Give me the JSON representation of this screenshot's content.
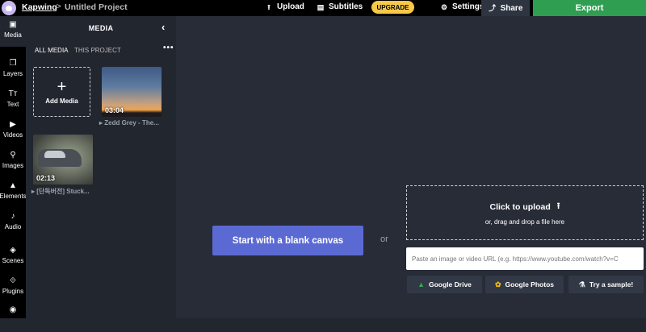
{
  "header": {
    "brand": "Kapwing",
    "separator": ">",
    "project_title": "Untitled Project",
    "upload_label": "Upload",
    "subtitles_label": "Subtitles",
    "upgrade_label": "UPGRADE",
    "settings_label": "Settings",
    "share_label": "Share",
    "export_label": "Export",
    "colors": {
      "upgrade": "#f7c948",
      "export": "#2f9e51"
    }
  },
  "sidebar": {
    "items": [
      {
        "label": "Media",
        "icon": "media-icon"
      },
      {
        "label": "Layers",
        "icon": "layers-icon"
      },
      {
        "label": "Text",
        "icon": "text-icon"
      },
      {
        "label": "Videos",
        "icon": "videos-icon"
      },
      {
        "label": "Images",
        "icon": "images-icon"
      },
      {
        "label": "Elements",
        "icon": "elements-icon"
      },
      {
        "label": "Audio",
        "icon": "audio-icon"
      },
      {
        "label": "Scenes",
        "icon": "scenes-icon"
      },
      {
        "label": "Plugins",
        "icon": "plugins-icon"
      }
    ]
  },
  "media_panel": {
    "title": "MEDIA",
    "tabs": [
      "ALL MEDIA",
      "THIS PROJECT"
    ],
    "more": "•••",
    "add_media_label": "Add Media",
    "items": [
      {
        "duration": "03:04",
        "title": "Zedd Grey - The..."
      },
      {
        "duration": "02:13",
        "title": "[단독버전] Stuck..."
      }
    ]
  },
  "workspace": {
    "blank_canvas_label": "Start with a blank canvas",
    "or_label": "or",
    "upload_title": "Click to upload",
    "upload_sub": "or, drag and drop a file here",
    "url_placeholder": "Paste an image or video URL (e.g. https://www.youtube.com/watch?v=C",
    "google_drive_label": "Google Drive",
    "google_photos_label": "Google Photos",
    "sample_label": "Try a sample!",
    "colors": {
      "blank_button": "#5b6ad3"
    }
  }
}
